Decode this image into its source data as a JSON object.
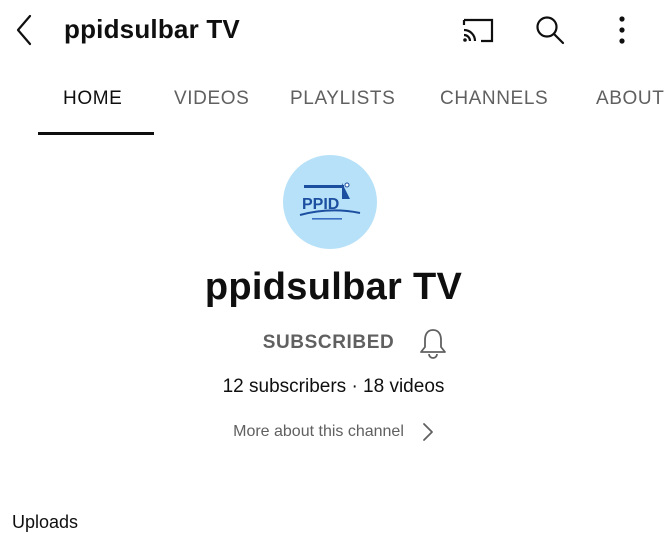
{
  "header": {
    "title": "ppidsulbar TV",
    "icons": [
      "back-chevron-icon",
      "cast-icon",
      "search-icon",
      "more-vertical-icon"
    ]
  },
  "tabs": [
    {
      "label": "HOME",
      "active": true
    },
    {
      "label": "VIDEOS",
      "active": false
    },
    {
      "label": "PLAYLISTS",
      "active": false
    },
    {
      "label": "CHANNELS",
      "active": false
    },
    {
      "label": "ABOUT",
      "active": false
    }
  ],
  "channel": {
    "avatar_text": "PPID",
    "name": "ppidsulbar TV",
    "subscribe_label": "SUBSCRIBED",
    "stats": "12 subscribers · 18 videos",
    "more_about": "More about this channel"
  },
  "sections": {
    "uploads_label": "Uploads"
  },
  "colors": {
    "avatar_bg": "#b7e1f8",
    "secondary_text": "#606060",
    "primary_text": "#0f0f0f",
    "logo_blue": "#1d4fa0"
  }
}
